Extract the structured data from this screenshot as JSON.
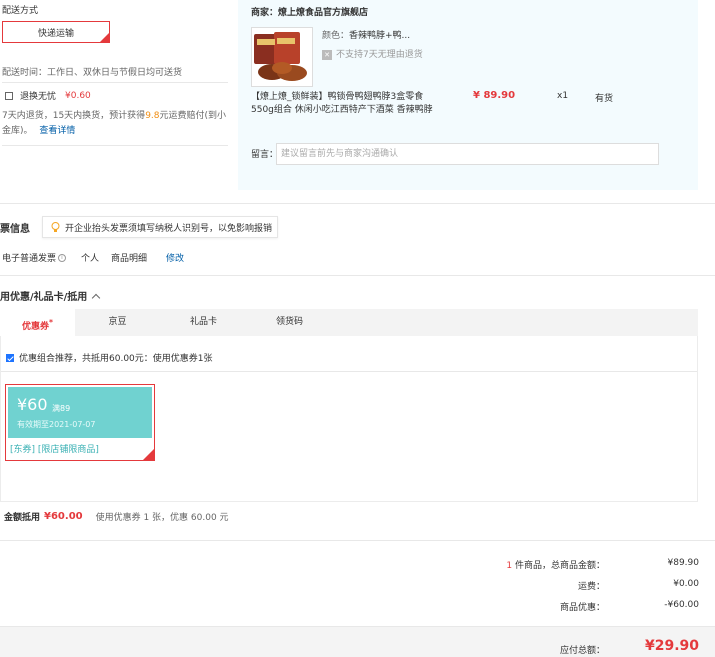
{
  "delivery": {
    "title": "配送方式",
    "method_button": "快递运输",
    "time": "配送时间：工作日、双休日与节假日均可送货",
    "insurance_label": "退换无忧",
    "insurance_price": "¥0.60",
    "insurance_desc_1": "7天内退货，15天内换货，预计获得",
    "insurance_amount": "9.8",
    "insurance_desc_2": "元运费赔付(到小",
    "insurance_desc_3": "金库)。",
    "insurance_link": "查看详情"
  },
  "merchant": {
    "label": "商家：",
    "name": "燎上燎食品官方旗舰店",
    "color_label": "颜色：",
    "color_value": "香辣鸭脖+鸭...",
    "no_return": "不支持7天无理由退货",
    "product_title_1": "【燎上燎_锁鲜装】鸭锁骨鸭翅鸭脖3盒零食",
    "product_title_2": "550g组合 休闲小吃江西特产下酒菜 香辣鸭脖",
    "price": "¥ 89.90",
    "qty": "x1",
    "stock": "有货",
    "memo_label": "留言：",
    "memo_placeholder": "建议留言前先与商家沟通确认"
  },
  "invoice": {
    "title": "票信息",
    "tip": "开企业抬头发票须填写纳税人识别号，以免影响报销",
    "type": "电子普通发票",
    "personal": "个人",
    "detail": "商品明细",
    "edit": "修改"
  },
  "discount": {
    "title": "用优惠/礼品卡/抵用",
    "tabs": [
      "优惠券",
      "京豆",
      "礼品卡",
      "领货码"
    ],
    "recommend": "优惠组合推荐，共抵用60.00元：使用优惠券1张",
    "coupon_amount": "¥60",
    "coupon_cond": "满89",
    "coupon_expire": "有效期至2021-07-07",
    "coupon_tags": "[东券] [限店铺限商品]",
    "total_label": "金额抵用",
    "total_value": "¥60.00",
    "total_desc": "使用优惠券 1 张，优惠 60.00 元"
  },
  "summary": {
    "count": "1",
    "count_suffix": "件商品，总商品金额：",
    "amount": "¥89.90",
    "freight_label": "运费：",
    "freight": "¥0.00",
    "discount_label": "商品优惠：",
    "discount": "-¥60.00",
    "payable_label": "应付总额：",
    "payable": "¥29.90"
  },
  "colors": {
    "accent": "#e4393c",
    "link": "#005ea7",
    "coupon": "#70d2d0"
  }
}
